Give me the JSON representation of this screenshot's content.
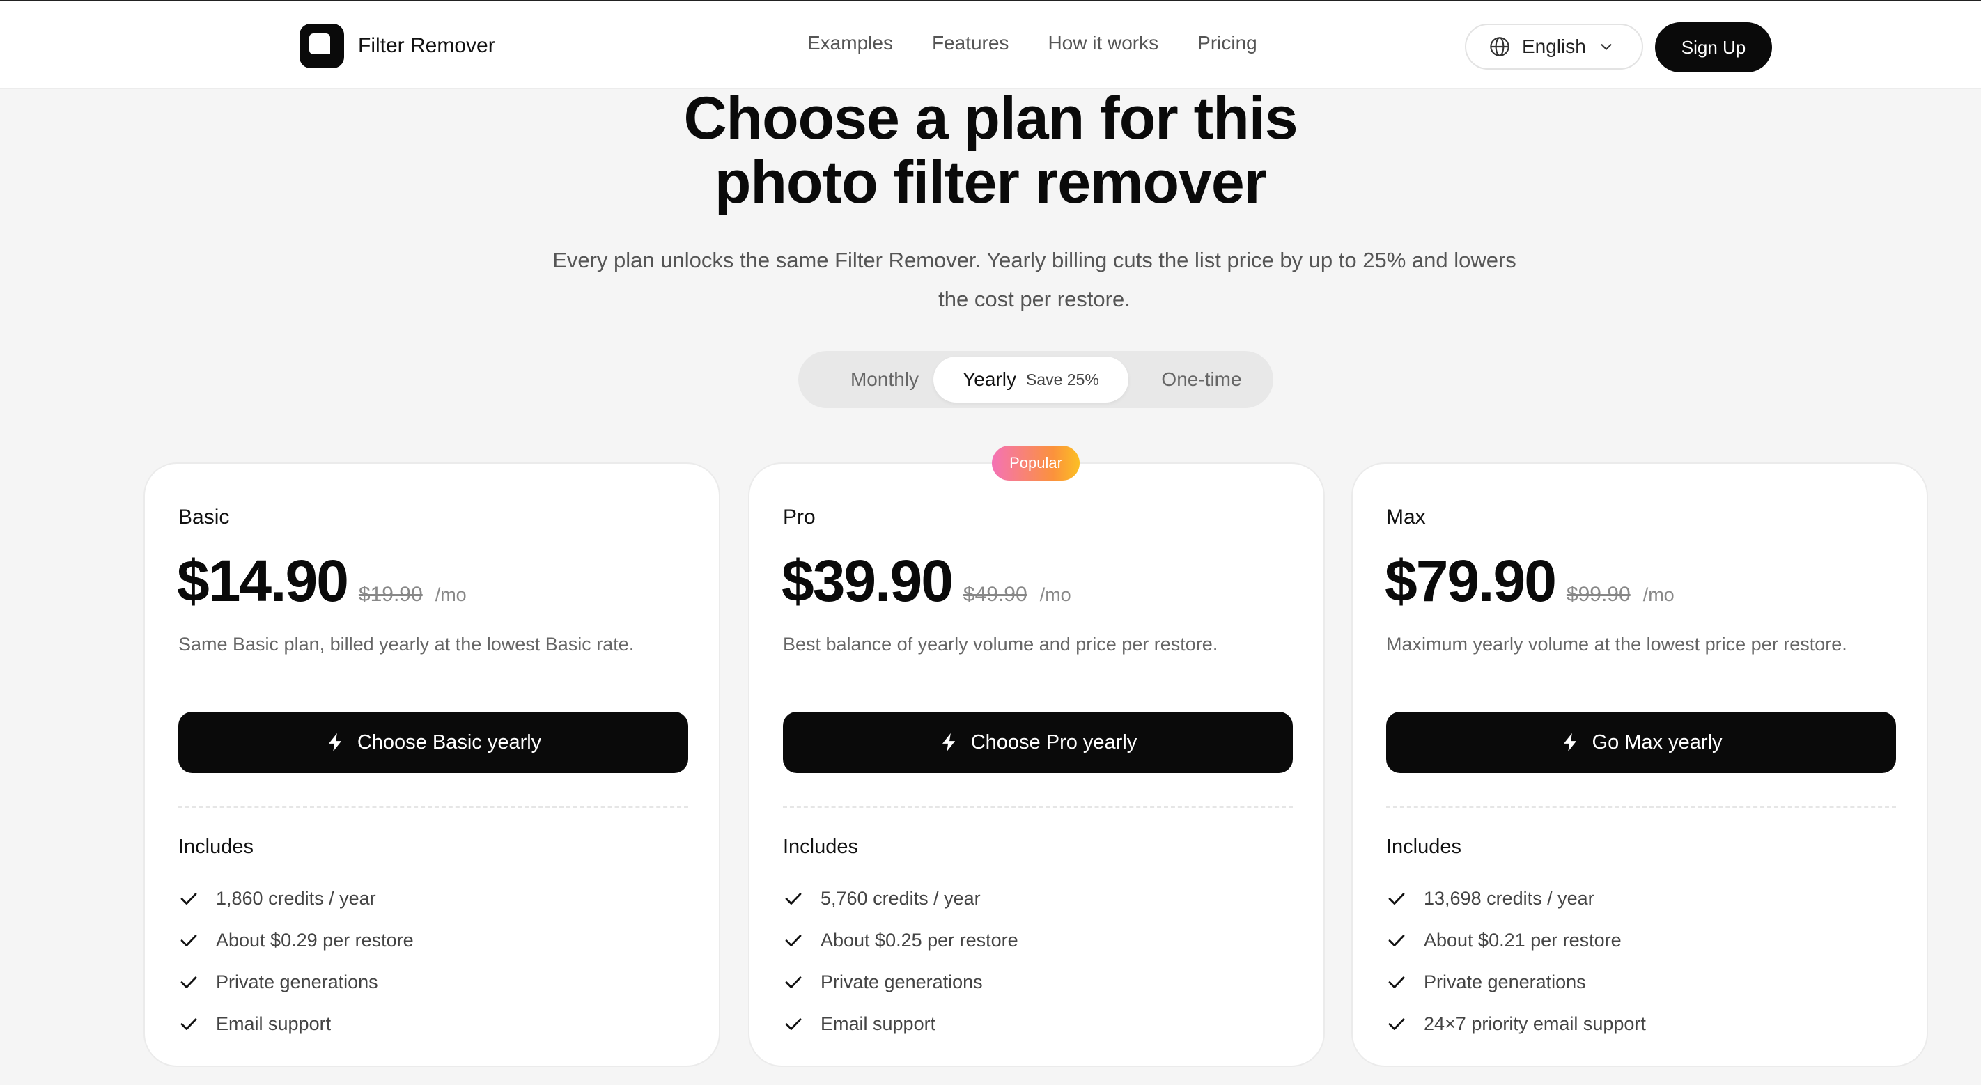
{
  "header": {
    "logo_text": "Filter Remover",
    "nav": [
      "Examples",
      "Features",
      "How it works",
      "Pricing"
    ],
    "language": "English",
    "signup_label": "Sign Up"
  },
  "hero": {
    "title_line1": "Choose a plan for this",
    "title_line2": "photo filter remover",
    "subtitle": "Every plan unlocks the same Filter Remover. Yearly billing cuts the list price by up to 25% and lowers the cost per restore."
  },
  "billing_toggle": {
    "monthly": "Monthly",
    "yearly": "Yearly",
    "yearly_badge": "Save 25%",
    "onetime": "One-time",
    "selected": "Yearly"
  },
  "badge": "Popular",
  "colors": {
    "accent": "#0a0a0a",
    "background": "#f5f5f5",
    "badge_gradient_start": "#f472b6",
    "badge_gradient_end": "#fbbf24"
  },
  "plans": [
    {
      "name": "Basic",
      "price": "$14.90",
      "old_price": "$19.90",
      "per": "/mo",
      "description": "Same Basic plan, billed yearly at the lowest Basic rate.",
      "cta": "Choose Basic yearly",
      "includes_label": "Includes",
      "features": [
        "1,860 credits / year",
        "About $0.29 per restore",
        "Private generations",
        "Email support"
      ]
    },
    {
      "name": "Pro",
      "price": "$39.90",
      "old_price": "$49.90",
      "per": "/mo",
      "description": "Best balance of yearly volume and price per restore.",
      "cta": "Choose Pro yearly",
      "includes_label": "Includes",
      "features": [
        "5,760 credits / year",
        "About $0.25 per restore",
        "Private generations",
        "Email support"
      ]
    },
    {
      "name": "Max",
      "price": "$79.90",
      "old_price": "$99.90",
      "per": "/mo",
      "description": "Maximum yearly volume at the lowest price per restore.",
      "cta": "Go Max yearly",
      "includes_label": "Includes",
      "features": [
        "13,698 credits / year",
        "About $0.21 per restore",
        "Private generations",
        "24×7 priority email support"
      ]
    }
  ]
}
